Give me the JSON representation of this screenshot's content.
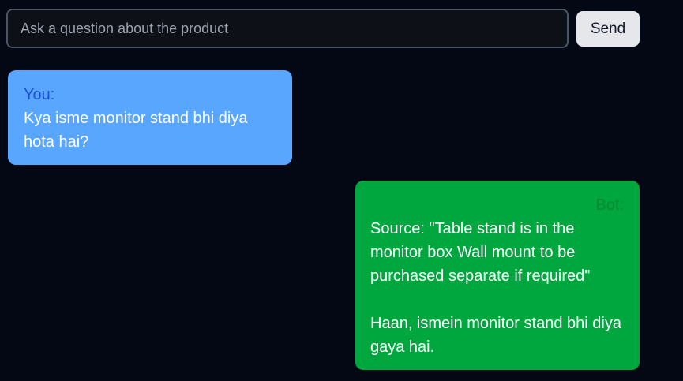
{
  "input": {
    "placeholder": "Ask a question about the product",
    "value": ""
  },
  "send_button": {
    "label": "Send"
  },
  "messages": [
    {
      "role": "user",
      "speaker": "You:",
      "text": "Kya isme monitor stand bhi diya hota hai?"
    },
    {
      "role": "bot",
      "speaker": "Bot:",
      "source": "Source: \"Table stand is in the monitor box Wall mount to be purchased separate if required\"",
      "text": "Haan, ismein monitor stand bhi diya gaya hai."
    }
  ],
  "colors": {
    "background": "#040814",
    "user_bubble": "#58a6ff",
    "bot_bubble": "#00a63e",
    "send_button": "#e5e7eb"
  }
}
